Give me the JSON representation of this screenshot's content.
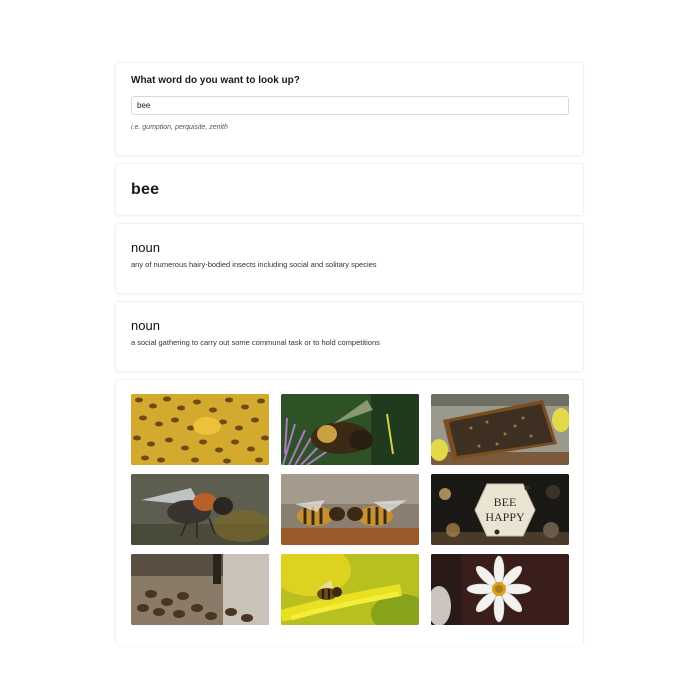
{
  "search": {
    "label": "What word do you want to look up?",
    "value": "bee",
    "hint": "i.e. gumption, perquisite, zenith"
  },
  "word": {
    "title": "bee"
  },
  "definitions": [
    {
      "part_of_speech": "noun",
      "text": "any of numerous hairy-bodied insects including social and solitary species"
    },
    {
      "part_of_speech": "noun",
      "text": "a social gathering to carry out some communal task or to hold competitions"
    }
  ],
  "gallery": {
    "sign_text_line1": "BEE",
    "sign_text_line2": "HAPPY"
  }
}
